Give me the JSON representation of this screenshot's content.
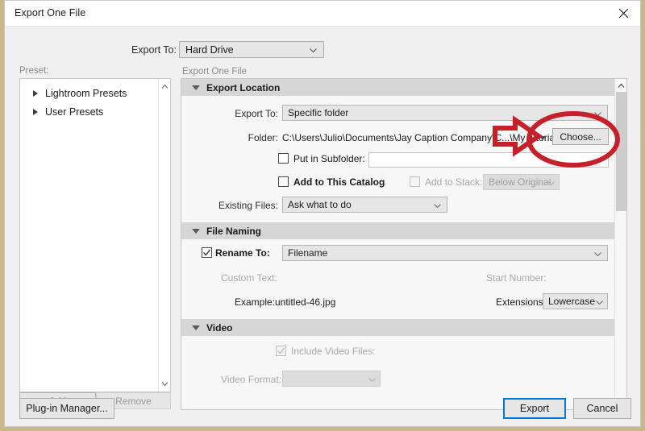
{
  "window": {
    "title": "Export One File",
    "close_icon": "close-icon"
  },
  "top": {
    "export_to_label": "Export To:",
    "export_to_value": "Hard Drive",
    "preset_label": "Preset:",
    "panel_caption": "Export One File"
  },
  "presets": {
    "items": [
      {
        "label": "Lightroom Presets"
      },
      {
        "label": "User Presets"
      }
    ],
    "add_label": "Add",
    "remove_label": "Remove"
  },
  "export_location": {
    "section_title": "Export Location",
    "export_to_label": "Export To:",
    "export_to_value": "Specific folder",
    "folder_label": "Folder:",
    "folder_value": "C:\\Users\\Julio\\Documents\\Jay Caption Company\\C...\\My tutorial photos",
    "choose_label": "Choose...",
    "put_in_subfolder_label": "Put in Subfolder:",
    "put_in_subfolder_value": "",
    "add_to_catalog_label": "Add to This Catalog",
    "add_to_stack_label": "Add to Stack:",
    "add_to_stack_value": "Below Original",
    "existing_files_label": "Existing Files:",
    "existing_files_value": "Ask what to do"
  },
  "file_naming": {
    "section_title": "File Naming",
    "rename_to_label": "Rename To:",
    "rename_to_value": "Filename",
    "custom_text_label": "Custom Text:",
    "start_number_label": "Start Number:",
    "example_label": "Example:",
    "example_value": "untitled-46.jpg",
    "extensions_label": "Extensions:",
    "extensions_value": "Lowercase"
  },
  "video": {
    "section_title": "Video",
    "include_video_label": "Include Video Files:",
    "video_format_label": "Video Format:",
    "video_format_value": ""
  },
  "footer": {
    "plugin_manager_label": "Plug-in Manager...",
    "export_label": "Export",
    "cancel_label": "Cancel"
  },
  "annotations": {
    "arrow_color": "#c8202a",
    "ellipse_color": "#c8202a"
  }
}
